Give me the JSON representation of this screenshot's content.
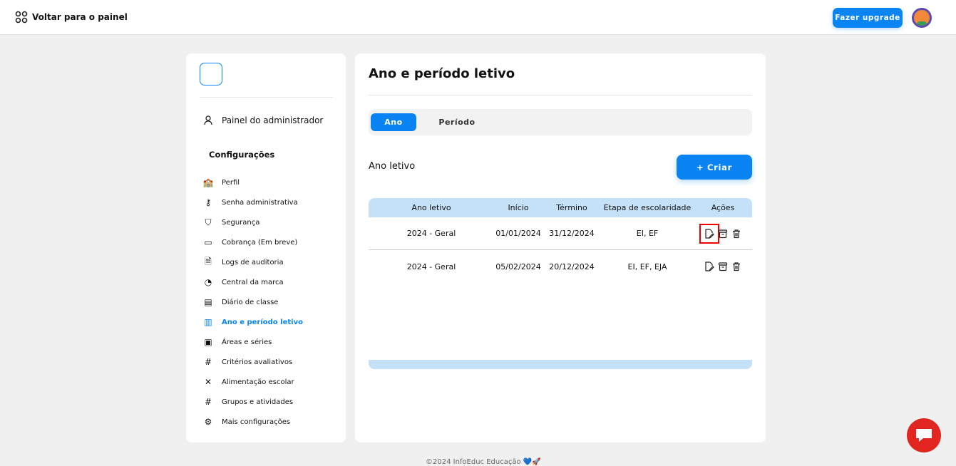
{
  "header": {
    "back_label": "Voltar para o painel",
    "upgrade_label": "Fazer upgrade"
  },
  "sidebar": {
    "admin_label": "Painel do administrador",
    "section_title": "Configurações",
    "items": [
      {
        "label": "Perfil",
        "icon": "building-icon"
      },
      {
        "label": "Senha administrativa",
        "icon": "key-icon"
      },
      {
        "label": "Segurança",
        "icon": "shield-icon"
      },
      {
        "label": "Cobrança (Em breve)",
        "icon": "wallet-icon"
      },
      {
        "label": "Logs de auditoria",
        "icon": "audit-file-icon"
      },
      {
        "label": "Central da marca",
        "icon": "palette-icon"
      },
      {
        "label": "Diário de classe",
        "icon": "document-icon"
      },
      {
        "label": "Ano e período letivo",
        "icon": "calendar-grid-icon",
        "active": true
      },
      {
        "label": "Áreas e séries",
        "icon": "list-card-icon"
      },
      {
        "label": "Critérios avaliativos",
        "icon": "hash-icon"
      },
      {
        "label": "Alimentação escolar",
        "icon": "utensils-icon"
      },
      {
        "label": "Grupos e atividades",
        "icon": "hash-icon"
      },
      {
        "label": "Mais configurações",
        "icon": "gear-icon"
      }
    ]
  },
  "main": {
    "title": "Ano e período letivo",
    "tabs": [
      "Ano",
      "Período"
    ],
    "subtitle": "Ano letivo",
    "create_label": "+ Criar",
    "columns": [
      "Ano letivo",
      "Início",
      "Término",
      "Etapa de escolaridade",
      "Ações"
    ],
    "rows": [
      [
        "2024 - Geral",
        "01/01/2024",
        "31/12/2024",
        "EI, EF"
      ],
      [
        "2024 - Geral",
        "05/02/2024",
        "20/12/2024",
        "EI, EF, EJA"
      ]
    ]
  },
  "footer": "©2024 InfoEduc Educação 💙🚀",
  "colors": {
    "accent": "#0a84f2",
    "table_header": "#c5e1f7",
    "chat": "#e0261f"
  }
}
